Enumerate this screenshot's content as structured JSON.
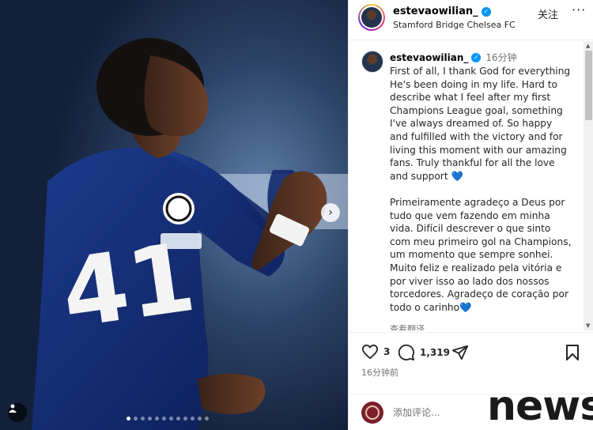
{
  "post": {
    "username": "estevaowilian_",
    "location": "Stamford Bridge Chelsea FC",
    "follow_label": "关注",
    "more_label": "···",
    "time_ago": "16分钟",
    "caption_en": "First of all, I thank God for everything He's been doing in my life. Hard to describe what I feel after my first Champions League goal, something I've always dreamed of. So happy and fulfilled with the victory and for living this moment with our amazing fans. Truly thankful for all the love and support",
    "caption_pt": "Primeiramente agradeço a Deus por tudo que vem fazendo em minha vida. Difícil descrever o que sinto com meu primeiro gol na Champions, um momento que sempre sonhei. Muito feliz e realizado pela vitória e por viver isso ao lado dos nossos torcedores. Agradeço de coração por todo o carinho",
    "heart_emoji": "💙",
    "translate_label": "查看翻译",
    "likes": "3",
    "comments": "1,319",
    "posted_ago": "16分钟前",
    "comment_placeholder": "添加评论...",
    "shirt_number": "41"
  },
  "watermark": "news",
  "carousel": {
    "count": 12,
    "active": 0
  },
  "colors": {
    "verified": "#0095f6",
    "photo_bg": "#23395a",
    "heart_blue": "#1a73e8"
  }
}
